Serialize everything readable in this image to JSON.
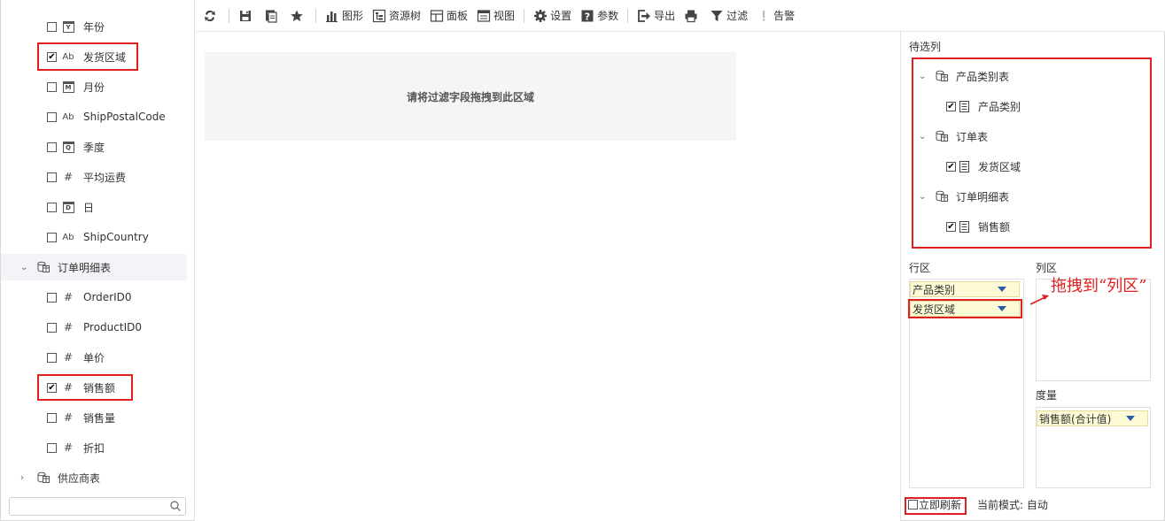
{
  "left_tree": {
    "fields_top": [
      {
        "label": "年份",
        "type": "date",
        "type_glyph": "Y",
        "checked": false
      },
      {
        "label": "发货区域",
        "type": "string",
        "checked": true
      },
      {
        "label": "月份",
        "type": "date",
        "type_glyph": "M",
        "checked": false
      },
      {
        "label": "ShipPostalCode",
        "type": "string",
        "checked": false
      },
      {
        "label": "季度",
        "type": "date",
        "type_glyph": "Q",
        "checked": false
      },
      {
        "label": "平均运费",
        "type": "number",
        "checked": false
      },
      {
        "label": "日",
        "type": "date",
        "type_glyph": "D",
        "checked": false
      },
      {
        "label": "ShipCountry",
        "type": "string",
        "checked": false
      }
    ],
    "table_order_detail": {
      "label": "订单明细表",
      "expanded": true
    },
    "fields_detail": [
      {
        "label": "OrderID0",
        "type": "number",
        "checked": false
      },
      {
        "label": "ProductID0",
        "type": "number",
        "checked": false
      },
      {
        "label": "单价",
        "type": "number",
        "checked": false
      },
      {
        "label": "销售额",
        "type": "number",
        "checked": true
      },
      {
        "label": "销售量",
        "type": "number",
        "checked": false
      },
      {
        "label": "折扣",
        "type": "number",
        "checked": false
      }
    ],
    "table_supplier": {
      "label": "供应商表",
      "expanded": false
    },
    "glyphs": {
      "string": "Ab",
      "number": "#",
      "check": "✔"
    }
  },
  "toolbar": {
    "chart": "图形",
    "resource_tree": "资源树",
    "panel": "面板",
    "view": "视图",
    "settings": "设置",
    "params": "参数",
    "export": "导出",
    "filter": "过滤",
    "alert": "告警"
  },
  "filter_zone": {
    "hint": "请将过滤字段拖拽到此区域"
  },
  "right_panel": {
    "candidates_title": "待选列",
    "candidates": [
      {
        "table": "产品类别表",
        "field": "产品类别"
      },
      {
        "table": "订单表",
        "field": "发货区域"
      },
      {
        "table": "订单明细表",
        "field": "销售额"
      }
    ],
    "rows_title": "行区",
    "columns_title": "列区",
    "measures_title": "度量",
    "row_fields": [
      "产品类别",
      "发货区域"
    ],
    "measure_fields": [
      "销售额(合计值)"
    ],
    "annotation": "拖拽到“列区”",
    "instant_refresh": "立即刷新",
    "mode_label": "当前模式: 自动"
  },
  "colors": {
    "highlight_red": "#e02020",
    "pill_bg": "#fdfbd6",
    "dropdown_blue": "#2a5aa8"
  }
}
